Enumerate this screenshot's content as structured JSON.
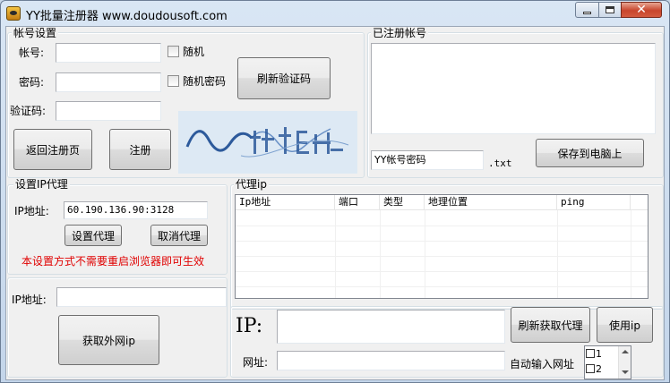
{
  "window": {
    "title": "YY批量注册器 www.doudousoft.com",
    "close_glyph": "✕"
  },
  "account_settings": {
    "legend": "帐号设置",
    "username_label": "帐号:",
    "username_value": "",
    "password_label": "密码:",
    "password_value": "",
    "captcha_label": "验证码:",
    "captcha_value": "",
    "random_label": "随机",
    "random_password_label": "随机密码",
    "refresh_captcha_button": "刷新验证码",
    "back_to_register_button": "返回注册页",
    "register_button": "注册"
  },
  "registered_accounts": {
    "legend": "已注册帐号",
    "content": "",
    "file_name_value": "YY帐号密码",
    "file_ext": ".txt",
    "save_button": "保存到电脑上"
  },
  "ip_proxy_settings": {
    "legend": "设置IP代理",
    "ip_label": "IP地址:",
    "ip_value": "60.190.136.90:3128",
    "set_proxy_button": "设置代理",
    "cancel_proxy_button": "取消代理",
    "notice": "本设置方式不需要重启浏览器即可生效"
  },
  "proxy_ip": {
    "legend": "代理ip",
    "columns": [
      "Ip地址",
      "端口",
      "类型",
      "地理位置",
      "ping"
    ]
  },
  "external_ip": {
    "label": "IP地址:",
    "value": "",
    "get_button": "获取外网ip"
  },
  "bottom": {
    "ip_label": "IP:",
    "ip_value": "",
    "url_label": "网址:",
    "url_value": "",
    "refresh_proxy_button": "刷新获取代理",
    "use_ip_button": "使用ip",
    "auto_input_label": "自动输入网址",
    "auto_items": [
      "1",
      "2"
    ]
  },
  "colors": {
    "notice": "#e00000",
    "captcha_ink": "#2d5a9b"
  }
}
